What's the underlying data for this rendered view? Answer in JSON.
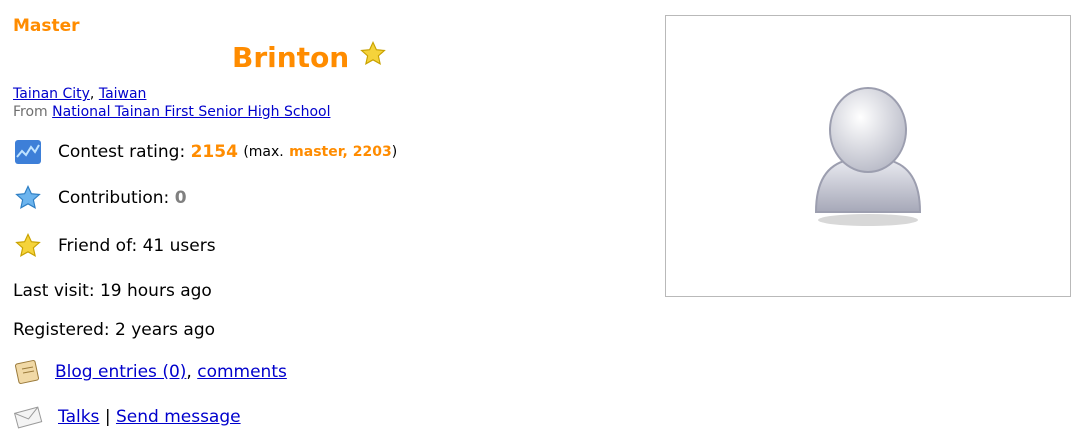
{
  "profile": {
    "rank": "Master",
    "handle": "Brinton",
    "city": "Tainan City",
    "country": "Taiwan",
    "from_prefix": "From",
    "organization": "National Tainan First Senior High School"
  },
  "stats": {
    "rating_label": "Contest rating:",
    "rating": "2154",
    "max_open": "(max.",
    "max_rank_rating": "master, 2203",
    "max_close": ")",
    "contribution_label": "Contribution:",
    "contribution": "0",
    "friend_label": "Friend of:",
    "friend_value": "41 users",
    "last_visit": "Last visit: 19 hours ago",
    "registered": "Registered: 2 years ago"
  },
  "links": {
    "blog_entries": "Blog entries (0)",
    "comments": "comments",
    "talks": "Talks",
    "separator": "|",
    "send_message": "Send message"
  },
  "colors": {
    "rank": "#ff8c00",
    "link": "#0000cc",
    "muted": "#808080"
  },
  "icons": [
    "rating-chart-icon",
    "contribution-star-icon",
    "friend-star-icon",
    "blog-icon",
    "envelope-icon",
    "avatar-placeholder-icon"
  ]
}
